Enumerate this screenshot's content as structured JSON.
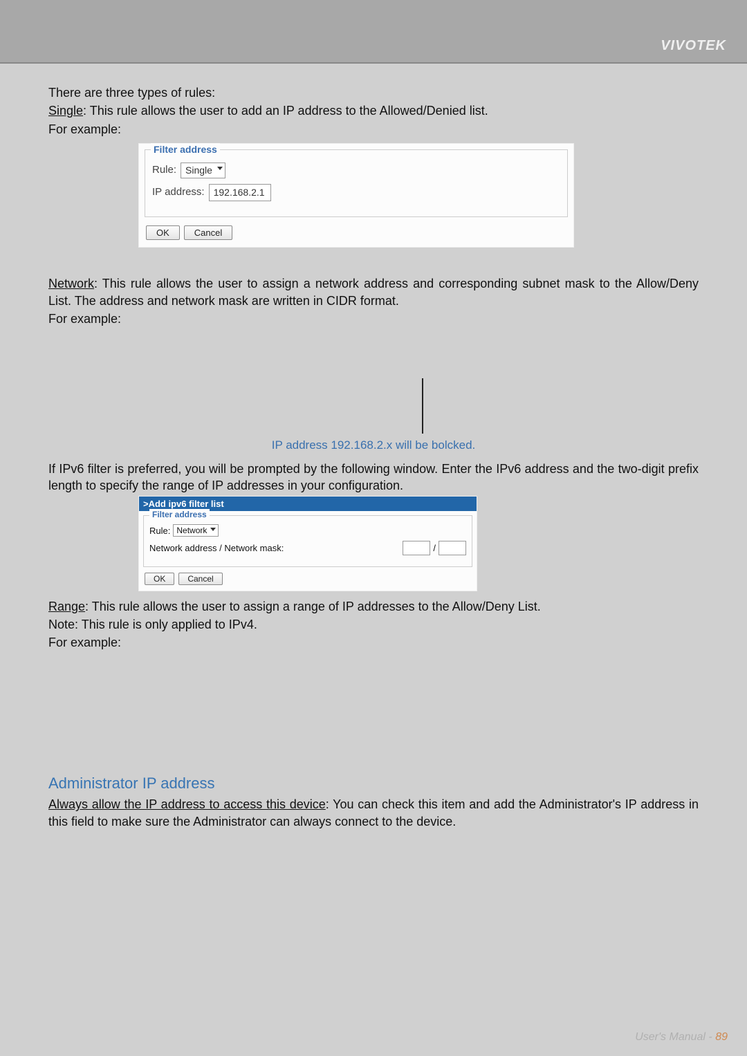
{
  "brand": "VIVOTEK",
  "intro": {
    "line1": "There are three types of rules:",
    "single_label": "Single",
    "single_desc": ": This rule allows the user to add an IP address to the Allowed/Denied list.",
    "for_example": "For example:"
  },
  "filter1": {
    "legend": "Filter address",
    "rule_label": "Rule:",
    "rule_value": "Single",
    "ip_label": "IP address:",
    "ip_value": "192.168.2.1",
    "ok": "OK",
    "cancel": "Cancel"
  },
  "network": {
    "label": "Network",
    "desc": ": This rule allows the user to assign a network address and corresponding subnet mask to the Allow/Deny List. The address and network mask are written in CIDR format.",
    "for_example": "For example:"
  },
  "caption1": "IP address 192.168.2.x will be bolcked.",
  "ipv6_note": "If IPv6 filter is preferred, you will be prompted by the following window. Enter the IPv6 address and the two-digit prefix length to specify the range of IP addresses in your configuration.",
  "ipv6box": {
    "title": ">Add ipv6 filter list",
    "legend": "Filter address",
    "rule_label": "Rule:",
    "rule_value": "Network",
    "mask_label": "Network address / Network mask:",
    "slash": "/",
    "ok": "OK",
    "cancel": "Cancel"
  },
  "range": {
    "label": "Range",
    "desc": ": This rule allows the user to assign a range of IP addresses to the Allow/Deny List.",
    "note": "Note: This rule is only applied to IPv4.",
    "for_example": "For example:"
  },
  "admin": {
    "title": "Administrator IP address",
    "label": "Always allow the IP address to access this device",
    "desc": ": You can check this item and add the Administrator's IP address in this field to make sure the Administrator can always connect to the device."
  },
  "footer": {
    "text": "User's Manual - ",
    "page": "89"
  }
}
